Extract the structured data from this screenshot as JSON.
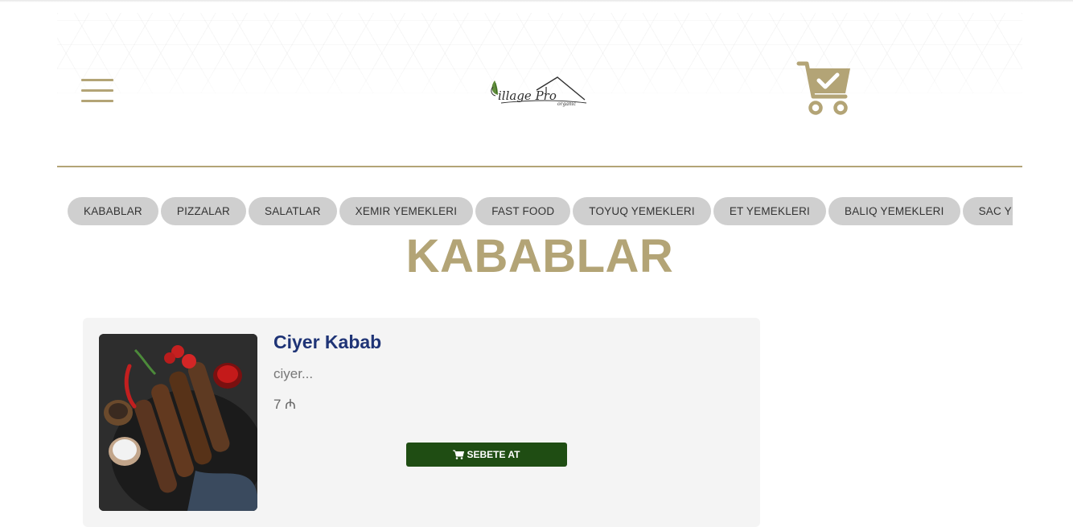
{
  "header": {
    "logo_text": "illage Pro",
    "logo_subtext": "organic",
    "menu_icon": "hamburger-menu-icon",
    "cart_icon": "cart-check-icon"
  },
  "categories": [
    "KABABLAR",
    "PIZZALAR",
    "SALATLAR",
    "XEMIR YEMEKLERI",
    "FAST FOOD",
    "TOYUQ YEMEKLERI",
    "ET YEMEKLERI",
    "BALIQ YEMEKLERI",
    "SAC YEMEKLERI"
  ],
  "section": {
    "title": "KABABLAR"
  },
  "products": [
    {
      "name": "Ciyer Kabab",
      "description": "ciyer...",
      "price": "7 ₼",
      "button_label": "SEBETE AT",
      "button_icon": "shopping-cart-icon"
    }
  ],
  "colors": {
    "accent": "#b3a476",
    "chip_bg": "#cfcfcf",
    "product_name": "#1f3476",
    "button_bg": "#1f4d13",
    "card_bg": "#f4f4f4"
  }
}
